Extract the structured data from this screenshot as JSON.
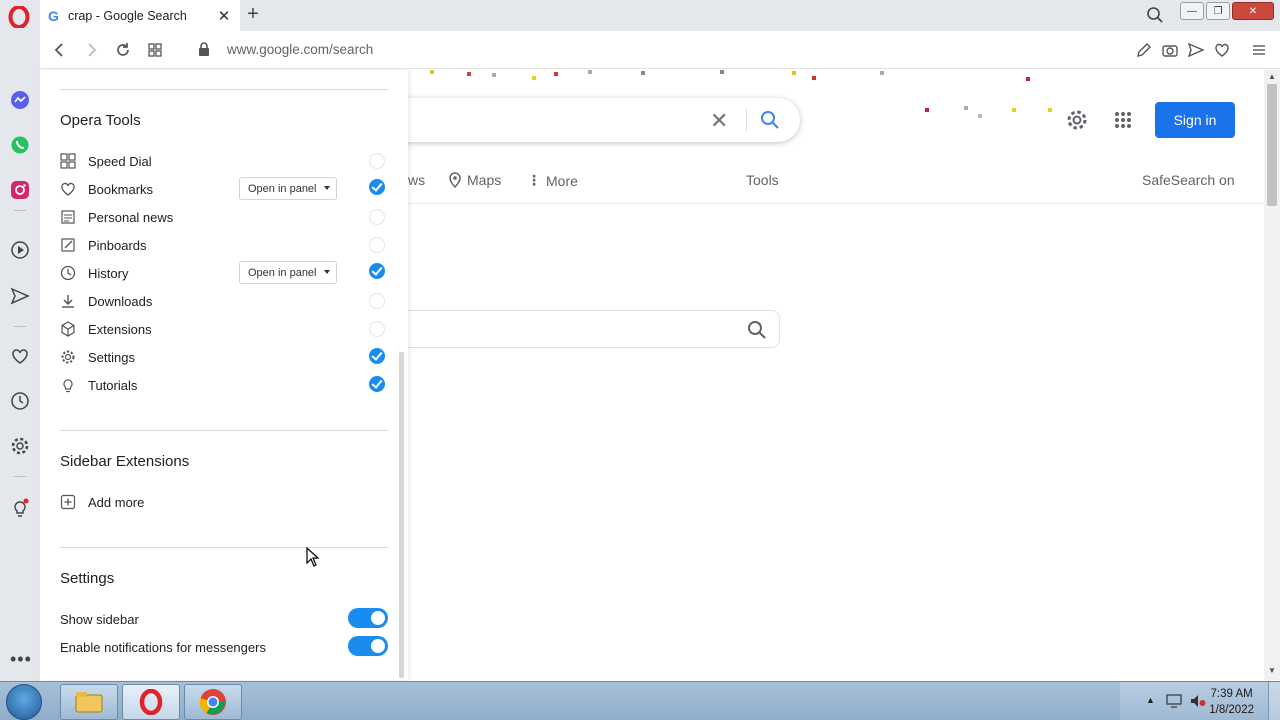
{
  "browser": {
    "tab_title": "crap - Google Search",
    "tab_favicon": "G",
    "url": "www.google.com/search"
  },
  "google": {
    "sign_in_label": "Sign in",
    "tabs": {
      "partial_tab": "ws",
      "maps": "Maps",
      "more": "More",
      "tools": "Tools",
      "safesearch": "SafeSearch on"
    }
  },
  "panel": {
    "opera_tools_title": "Opera Tools",
    "tools": [
      {
        "label": "Speed Dial",
        "icon": "speed-dial-icon",
        "checked": false,
        "dropdown": ""
      },
      {
        "label": "Bookmarks",
        "icon": "heart-icon",
        "checked": true,
        "dropdown": "Open in panel"
      },
      {
        "label": "Personal news",
        "icon": "news-icon",
        "checked": false,
        "dropdown": ""
      },
      {
        "label": "Pinboards",
        "icon": "pinboard-icon",
        "checked": false,
        "dropdown": ""
      },
      {
        "label": "History",
        "icon": "clock-icon",
        "checked": true,
        "dropdown": "Open in panel"
      },
      {
        "label": "Downloads",
        "icon": "download-icon",
        "checked": false,
        "dropdown": ""
      },
      {
        "label": "Extensions",
        "icon": "cube-icon",
        "checked": false,
        "dropdown": ""
      },
      {
        "label": "Settings",
        "icon": "gear-icon",
        "checked": true,
        "dropdown": ""
      },
      {
        "label": "Tutorials",
        "icon": "lightbulb-icon",
        "checked": true,
        "dropdown": ""
      }
    ],
    "sidebar_ext_title": "Sidebar Extensions",
    "add_more_label": "Add more",
    "settings_title": "Settings",
    "settings": [
      {
        "label": "Show sidebar",
        "enabled": true
      },
      {
        "label": "Enable notifications for messengers",
        "enabled": true
      }
    ]
  },
  "taskbar": {
    "time": "7:39 AM",
    "date": "1/8/2022"
  },
  "colors": {
    "accent": "#1a8cf0",
    "google_blue": "#1a73e8",
    "opera_red": "#e0222c"
  }
}
